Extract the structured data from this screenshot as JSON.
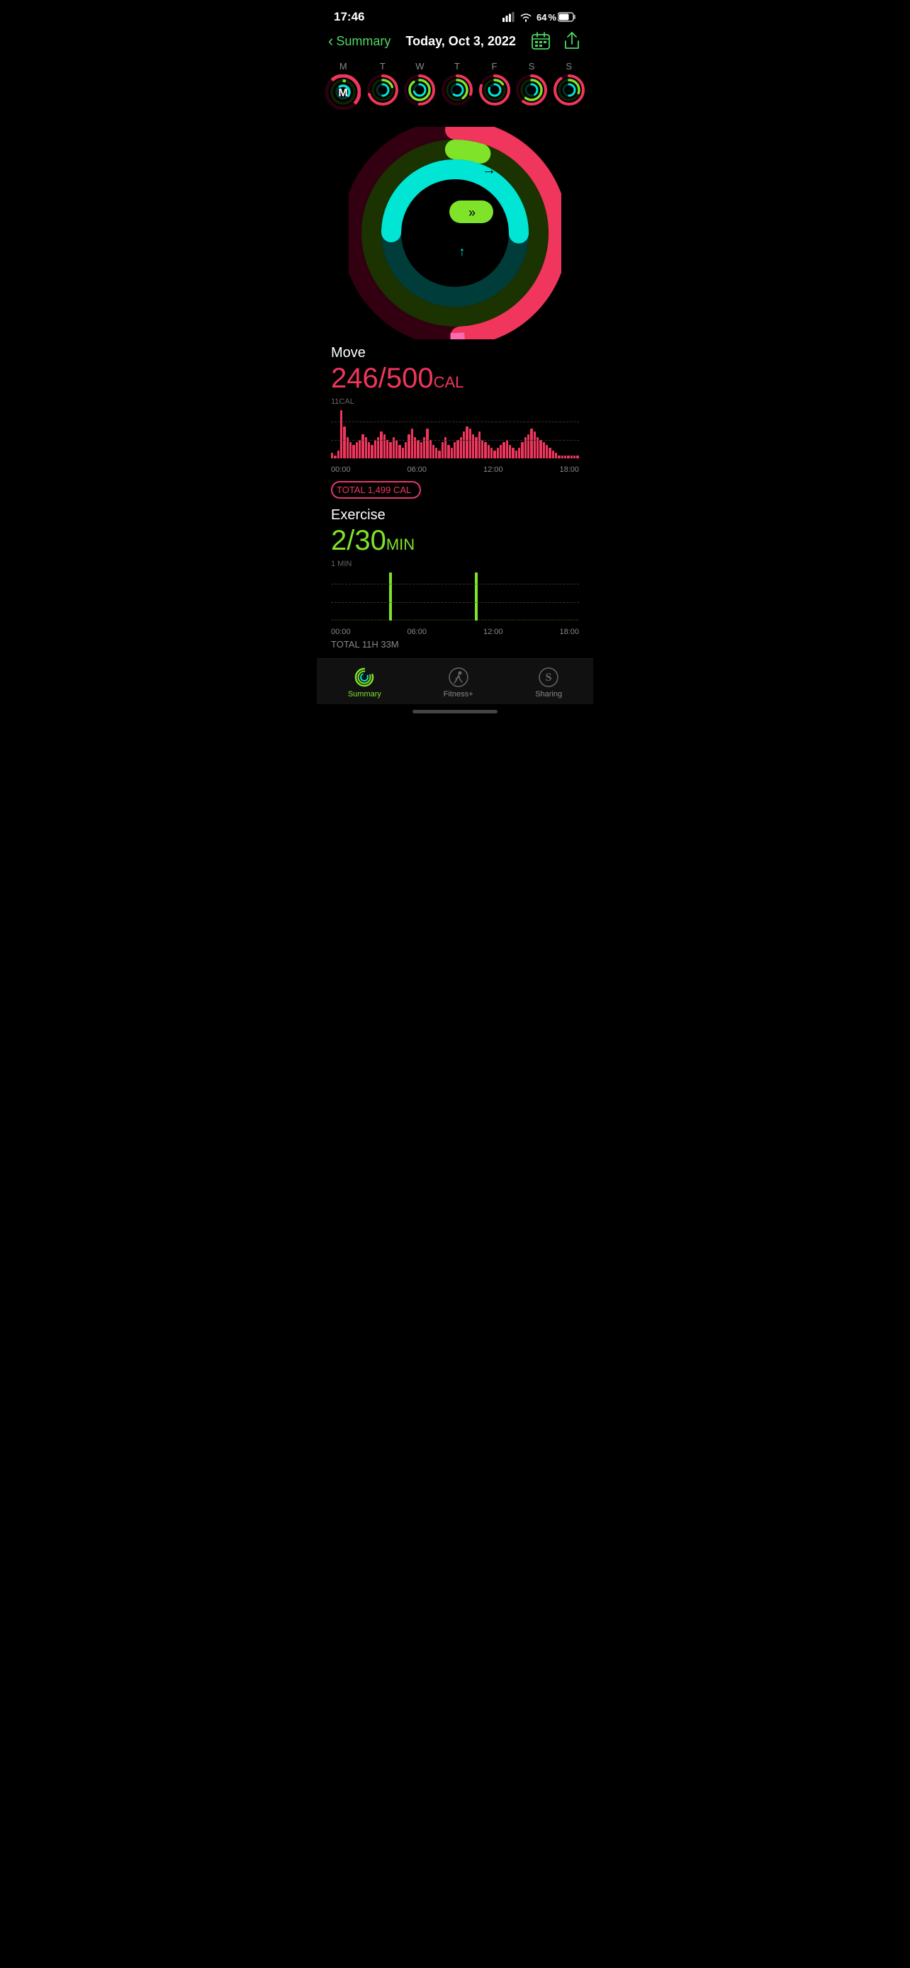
{
  "statusBar": {
    "time": "17:46",
    "battery": "64"
  },
  "navBar": {
    "backLabel": "Summary",
    "title": "Today, Oct 3, 2022"
  },
  "days": [
    {
      "letter": "M",
      "selected": true
    },
    {
      "letter": "T",
      "selected": false
    },
    {
      "letter": "W",
      "selected": false
    },
    {
      "letter": "T",
      "selected": false
    },
    {
      "letter": "F",
      "selected": false
    },
    {
      "letter": "S",
      "selected": false
    },
    {
      "letter": "S",
      "selected": false
    }
  ],
  "rings": {
    "move": {
      "current": 246,
      "goal": 500,
      "color": "#f0365c",
      "pct": 0.492
    },
    "exercise": {
      "current": 2,
      "goal": 30,
      "color": "#7ee329",
      "pct": 0.067
    },
    "stand": {
      "current": 6,
      "goal": 12,
      "color": "#00e5d4",
      "pct": 0.5
    }
  },
  "move": {
    "label": "Move",
    "value": "246/500",
    "unit": "CAL",
    "chartTopLabel": "11CAL",
    "total": "TOTAL 1,499 CAL",
    "timeLabels": [
      "00:00",
      "06:00",
      "12:00",
      "18:00"
    ]
  },
  "exercise": {
    "label": "Exercise",
    "value": "2/30",
    "unit": "MIN",
    "chartTopLabel": "1 MIN",
    "total": "TOTAL 11H 33M",
    "timeLabels": [
      "00:00",
      "06:00",
      "12:00",
      "18:00"
    ]
  },
  "tabs": [
    {
      "label": "Summary",
      "active": true,
      "icon": "rings"
    },
    {
      "label": "Fitness+",
      "active": false,
      "icon": "runner"
    },
    {
      "label": "Sharing",
      "active": false,
      "icon": "sharing"
    }
  ],
  "moveBars": [
    2,
    1,
    3,
    18,
    12,
    8,
    6,
    5,
    6,
    7,
    9,
    8,
    6,
    5,
    7,
    8,
    10,
    9,
    7,
    6,
    8,
    7,
    5,
    4,
    6,
    9,
    11,
    8,
    7,
    6,
    8,
    11,
    7,
    5,
    4,
    3,
    6,
    8,
    5,
    4,
    6,
    7,
    8,
    10,
    12,
    11,
    9,
    8,
    10,
    7,
    6,
    5,
    4,
    3,
    4,
    5,
    6,
    7,
    5,
    4,
    3,
    4,
    6,
    8,
    9,
    11,
    10,
    8,
    7,
    6,
    5,
    4,
    3,
    2,
    1,
    1,
    1,
    1,
    1,
    1,
    1
  ],
  "exerciseBars": [
    0,
    0,
    0,
    0,
    0,
    0,
    0,
    0,
    0,
    0,
    0,
    0,
    0,
    0,
    0,
    0,
    0,
    0,
    0,
    100,
    0,
    0,
    0,
    0,
    0,
    0,
    0,
    0,
    0,
    0,
    0,
    0,
    0,
    0,
    0,
    0,
    0,
    0,
    0,
    0,
    0,
    0,
    0,
    0,
    0,
    0,
    0,
    100,
    0,
    0,
    0,
    0,
    0,
    0,
    0,
    0,
    0,
    0,
    0,
    0,
    0,
    0,
    0,
    0,
    0,
    0,
    0,
    0,
    0,
    0,
    0,
    0,
    0,
    0,
    0,
    0,
    0,
    0,
    0,
    0,
    0
  ]
}
